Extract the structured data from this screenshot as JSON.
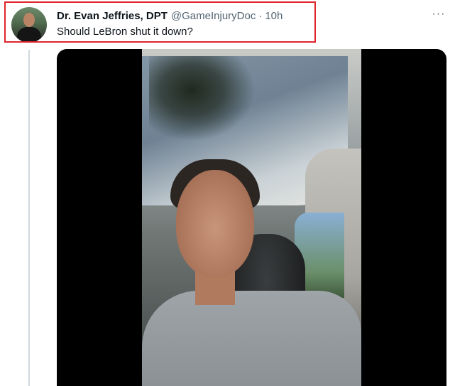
{
  "tweet": {
    "author_name": "Dr. Evan Jeffries, DPT",
    "handle": "@GameInjuryDoc",
    "separator": "·",
    "time": "10h",
    "text": "Should LeBron shut it down?",
    "more_icon": "···"
  },
  "media": {
    "type": "video",
    "icon": "video-frame"
  },
  "colors": {
    "highlight_border": "#e0242b",
    "text_primary": "#0f1419",
    "text_secondary": "#536471"
  }
}
